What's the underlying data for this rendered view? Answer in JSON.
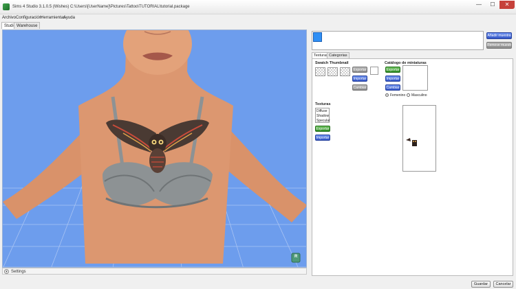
{
  "window": {
    "title": "Sims 4 Studio 3.1.0.5 (Wishes)  C:\\Users\\[UserName]\\Pictures\\Tattoo\\TUTORIAL\\tutorial.package",
    "minimize": "—",
    "maximize": "☐",
    "close": "✕"
  },
  "menu": {
    "items": [
      "Archivo",
      "Configuración",
      "Herramientas",
      "Ayuda"
    ]
  },
  "main_tabs": [
    {
      "label": "Studio",
      "active": true
    },
    {
      "label": "Warehouse",
      "active": false
    }
  ],
  "viewport": {
    "settings_label": "Settings",
    "settings_icon": "chevron-down-icon",
    "corner_badge": "R"
  },
  "swatch_panel": {
    "add_button": "Añadir muestra",
    "remove_button": "Remove muestra"
  },
  "inner_tabs": [
    {
      "label": "Texturas",
      "active": true
    },
    {
      "label": "Categorias",
      "active": false
    }
  ],
  "swatch_thumbnail": {
    "label": "Swatch Thumbnail",
    "export": "Exportar",
    "import": "Importar",
    "change": "Cambiar"
  },
  "thumbnail_catalog": {
    "label": "Catálogo de miniaturas",
    "export": "Exportar",
    "import": "Importar",
    "change": "Cambiar",
    "gender_options": [
      {
        "label": "Femenino",
        "selected": true
      },
      {
        "label": "Masculino",
        "selected": false
      }
    ]
  },
  "textures": {
    "label": "Texturas",
    "list": [
      "Diffuse",
      "Shadow",
      "Specular"
    ],
    "export": "Exportar",
    "import": "Importar"
  },
  "footer": {
    "save": "Guardar",
    "cancel": "Cancelar"
  },
  "colors": {
    "viewport_bg": "#6d9ded",
    "grid_line": "#a9c4f3",
    "skin": "#d9926a",
    "bra": "#8d9294",
    "button_blue": "#3456c5",
    "button_green": "#2f8a24",
    "swatch": "#2f8ff5"
  }
}
